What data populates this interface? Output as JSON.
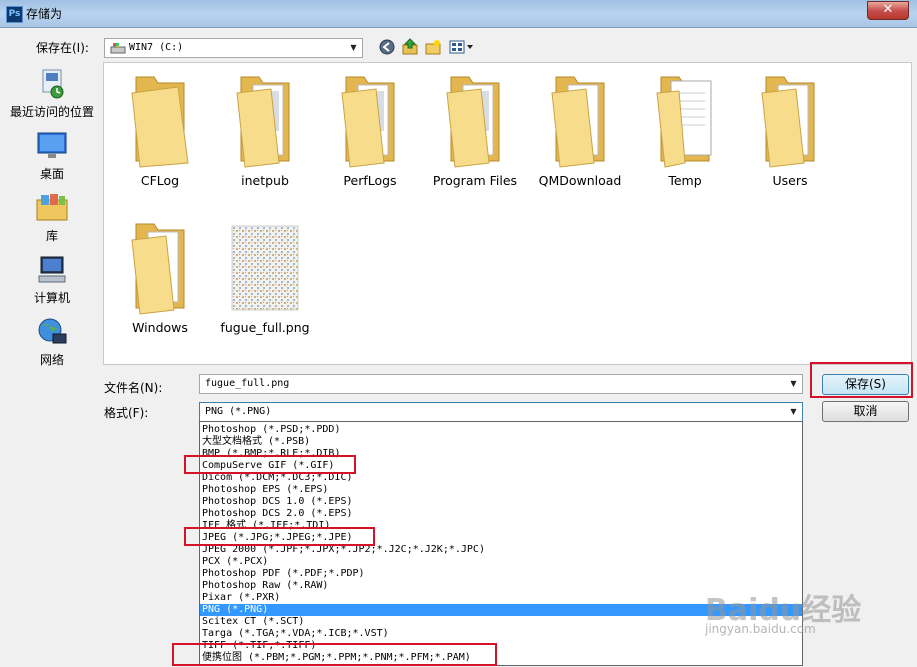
{
  "window": {
    "title": "存储为",
    "app_icon_text": "Ps",
    "close_symbol": "✕"
  },
  "toolbar": {
    "save_in_label": "保存在(I):",
    "location": "WIN7 (C:)"
  },
  "places": [
    {
      "label": "最近访问的位置",
      "icon": "recent-places-icon"
    },
    {
      "label": "桌面",
      "icon": "desktop-icon"
    },
    {
      "label": "库",
      "icon": "libraries-icon"
    },
    {
      "label": "计算机",
      "icon": "computer-icon"
    },
    {
      "label": "网络",
      "icon": "network-icon"
    }
  ],
  "files": [
    {
      "name": "CFLog",
      "type": "folder"
    },
    {
      "name": "inetpub",
      "type": "folder"
    },
    {
      "name": "PerfLogs",
      "type": "folder"
    },
    {
      "name": "Program Files",
      "type": "folder"
    },
    {
      "name": "QMDownload",
      "type": "folder"
    },
    {
      "name": "Temp",
      "type": "folder-doc"
    },
    {
      "name": "Users",
      "type": "folder"
    },
    {
      "name": "Windows",
      "type": "folder"
    },
    {
      "name": "fugue_full.png",
      "type": "image"
    }
  ],
  "form": {
    "filename_label": "文件名(N):",
    "filename_value": "fugue_full.png",
    "format_label": "格式(F):",
    "format_value": "PNG (*.PNG)",
    "save_button": "保存(S)",
    "cancel_button": "取消"
  },
  "format_options": [
    "Photoshop (*.PSD;*.PDD)",
    "大型文档格式 (*.PSB)",
    "BMP (*.BMP;*.RLE;*.DIB)",
    "CompuServe GIF (*.GIF)",
    "Dicom (*.DCM;*.DC3;*.DIC)",
    "Photoshop EPS (*.EPS)",
    "Photoshop DCS 1.0 (*.EPS)",
    "Photoshop DCS 2.0 (*.EPS)",
    "IFF 格式 (*.IFF;*.TDI)",
    "JPEG (*.JPG;*.JPEG;*.JPE)",
    "JPEG 2000 (*.JPF;*.JPX;*.JP2;*.J2C;*.J2K;*.JPC)",
    "PCX (*.PCX)",
    "Photoshop PDF (*.PDF;*.PDP)",
    "Photoshop Raw (*.RAW)",
    "Pixar (*.PXR)",
    "PNG (*.PNG)",
    "Scitex CT (*.SCT)",
    "Targa (*.TGA;*.VDA;*.ICB;*.VST)",
    "TIFF (*.TIF;*.TIFF)",
    "便携位图 (*.PBM;*.PGM;*.PPM;*.PNM;*.PFM;*.PAM)"
  ],
  "selected_format_index": 15,
  "watermark": {
    "brand": "Baidu经验",
    "url": "jingyan.baidu.com"
  },
  "colors": {
    "highlight": "#d4132a",
    "selection": "#3399ff",
    "folder": "#f3d27a"
  }
}
